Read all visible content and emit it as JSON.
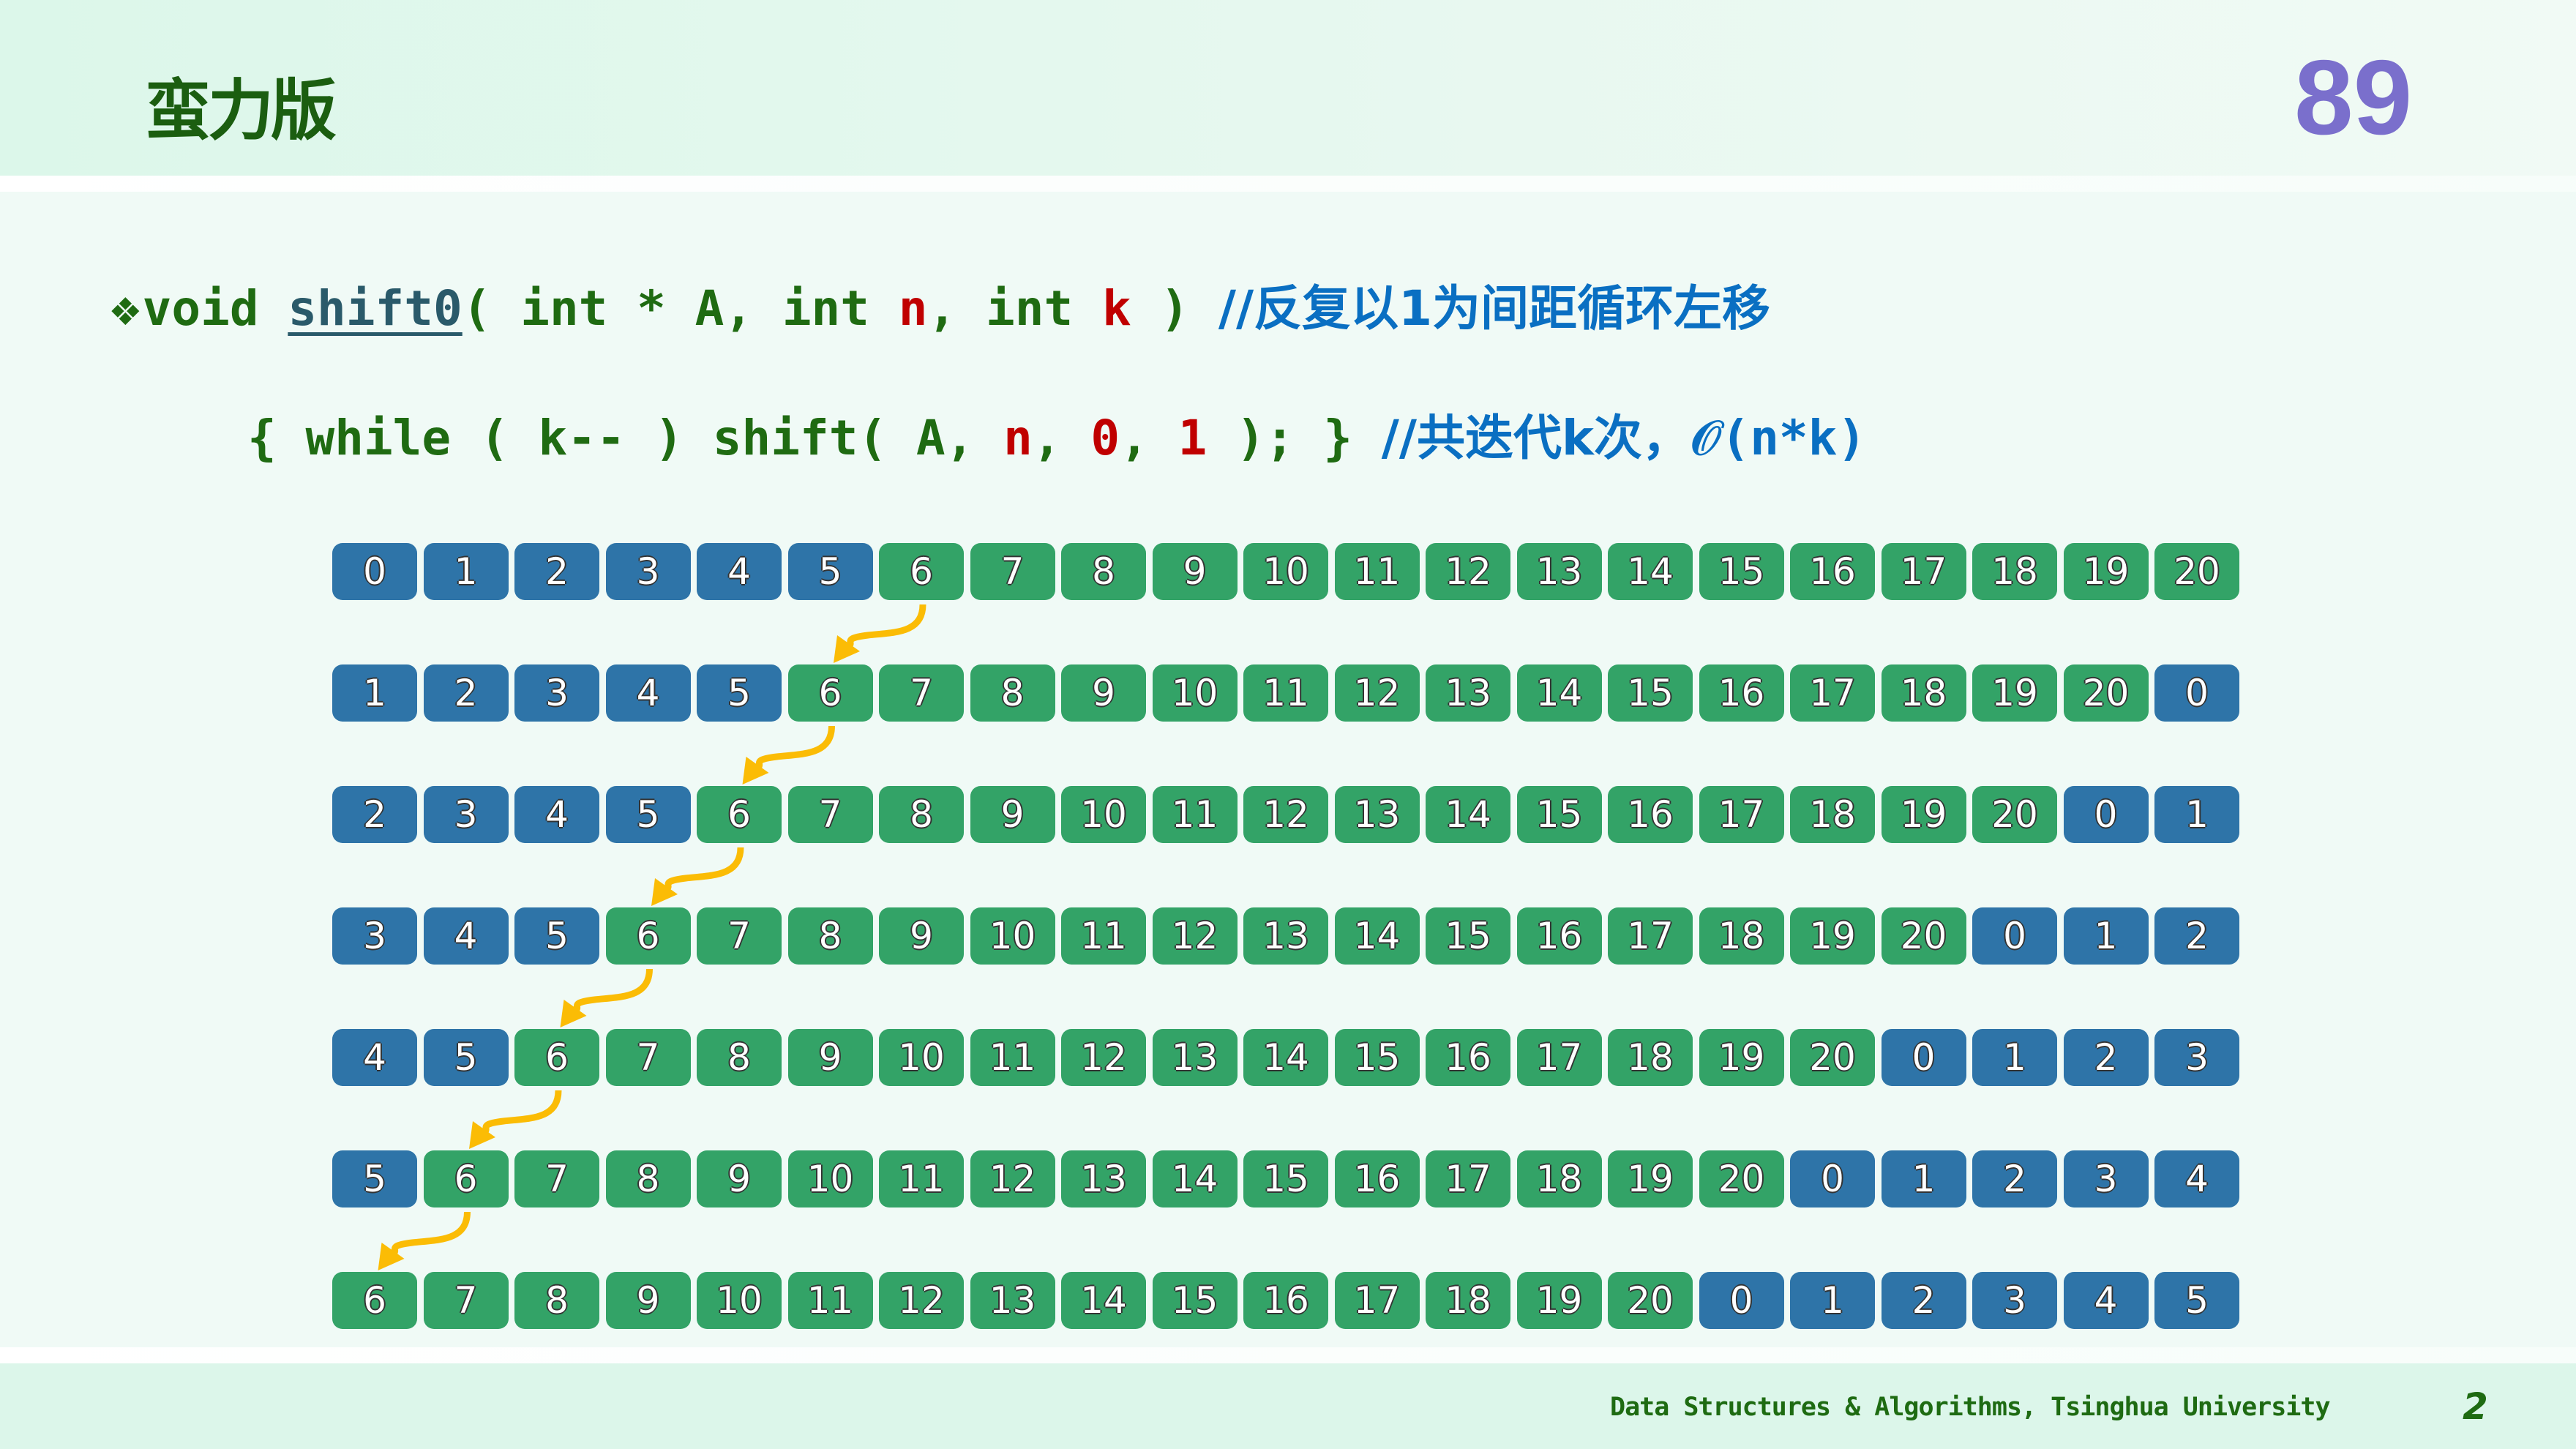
{
  "header": {
    "title": "蛮力版",
    "page_number": "89"
  },
  "code": {
    "bullet": "❖",
    "line1": {
      "p1": "void ",
      "fn": "shift0",
      "p2": "( int * A, int ",
      "n": "n",
      "p3": ", int ",
      "k": "k",
      "p4": " ) ",
      "comment": "//反复以1为间距循环左移"
    },
    "line2": {
      "p1": "{ while ( k-- ) shift( A, ",
      "n": "n",
      "p2": ", ",
      "zero": "0",
      "p3": ", ",
      "one": "1",
      "p4": " ); } ",
      "comment": "//共迭代k次，",
      "complexity": "𝒪(n*k)"
    }
  },
  "colors": {
    "blue": "#2e74a8",
    "green": "#33a367",
    "arrow": "#fbbc05"
  },
  "rows": [
    [
      0,
      1,
      2,
      3,
      4,
      5,
      6,
      7,
      8,
      9,
      10,
      11,
      12,
      13,
      14,
      15,
      16,
      17,
      18,
      19,
      20
    ],
    [
      1,
      2,
      3,
      4,
      5,
      6,
      7,
      8,
      9,
      10,
      11,
      12,
      13,
      14,
      15,
      16,
      17,
      18,
      19,
      20,
      0
    ],
    [
      2,
      3,
      4,
      5,
      6,
      7,
      8,
      9,
      10,
      11,
      12,
      13,
      14,
      15,
      16,
      17,
      18,
      19,
      20,
      0,
      1
    ],
    [
      3,
      4,
      5,
      6,
      7,
      8,
      9,
      10,
      11,
      12,
      13,
      14,
      15,
      16,
      17,
      18,
      19,
      20,
      0,
      1,
      2
    ],
    [
      4,
      5,
      6,
      7,
      8,
      9,
      10,
      11,
      12,
      13,
      14,
      15,
      16,
      17,
      18,
      19,
      20,
      0,
      1,
      2,
      3
    ],
    [
      5,
      6,
      7,
      8,
      9,
      10,
      11,
      12,
      13,
      14,
      15,
      16,
      17,
      18,
      19,
      20,
      0,
      1,
      2,
      3,
      4
    ],
    [
      6,
      7,
      8,
      9,
      10,
      11,
      12,
      13,
      14,
      15,
      16,
      17,
      18,
      19,
      20,
      0,
      1,
      2,
      3,
      4,
      5
    ]
  ],
  "blue_values": [
    0,
    1,
    2,
    3,
    4,
    5
  ],
  "footer": {
    "text": "Data Structures & Algorithms, Tsinghua University",
    "page": "2"
  }
}
